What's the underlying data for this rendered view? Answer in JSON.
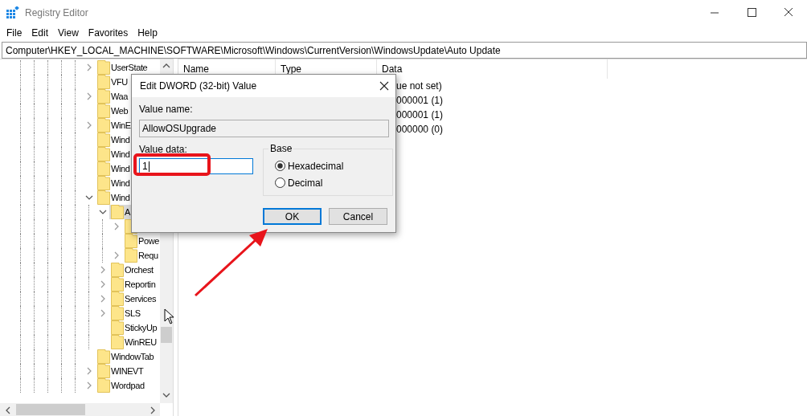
{
  "window": {
    "title": "Registry Editor"
  },
  "menu": [
    "File",
    "Edit",
    "View",
    "Favorites",
    "Help"
  ],
  "address": "Computer\\HKEY_LOCAL_MACHINE\\SOFTWARE\\Microsoft\\Windows\\CurrentVersion\\WindowsUpdate\\Auto Update",
  "tree": [
    {
      "label": "UserState",
      "expanded": false,
      "selected": false
    },
    {
      "label": "VFU",
      "selected": false
    },
    {
      "label": "Waa",
      "expanded": false,
      "selected": false
    },
    {
      "label": "Web",
      "selected": false
    },
    {
      "label": "WinE",
      "expanded": false,
      "selected": false
    },
    {
      "label": "Wind",
      "selected": false
    },
    {
      "label": "Wind",
      "selected": false
    },
    {
      "label": "Wind",
      "selected": false
    },
    {
      "label": "Wind",
      "selected": false
    },
    {
      "label": "Wind",
      "expanded": true,
      "selected": false,
      "children": [
        {
          "label": "A",
          "expanded": true,
          "selected": true,
          "children": [
            {
              "expanded": false,
              "selected": false
            },
            {
              "label": "Powe",
              "selected": false
            },
            {
              "label": "Requ",
              "expanded": false,
              "selected": false
            }
          ]
        },
        {
          "label": "Orchest",
          "expanded": false,
          "selected": false
        },
        {
          "label": "Reportin",
          "expanded": false,
          "selected": false
        },
        {
          "label": "Services",
          "expanded": false,
          "selected": false
        },
        {
          "label": "SLS",
          "expanded": false,
          "selected": false
        },
        {
          "label": "StickyUp",
          "selected": false
        },
        {
          "label": "WinREU",
          "selected": false
        }
      ]
    },
    {
      "label": "WindowTab",
      "selected": false
    },
    {
      "label": "WINEVT",
      "expanded": false,
      "selected": false
    },
    {
      "label": "Wordpad",
      "expanded": false,
      "selected": false
    }
  ],
  "values": {
    "columns": [
      "Name",
      "Type",
      "Data"
    ],
    "rows": [
      {
        "data": "ue not set)"
      },
      {
        "data": "000001 (1)"
      },
      {
        "data": "000001 (1)"
      },
      {
        "data": "000000 (0)"
      }
    ]
  },
  "dialog": {
    "title": "Edit DWORD (32-bit) Value",
    "name_label": "Value name:",
    "name_value": "AllowOSUpgrade",
    "data_label": "Value data:",
    "data_value": "1",
    "base_label": "Base",
    "base_options": [
      {
        "label": "Hexadecimal",
        "selected": true
      },
      {
        "label": "Decimal",
        "selected": false
      }
    ],
    "buttons": [
      {
        "label": "OK",
        "focused": true
      },
      {
        "label": "Cancel",
        "focused": false
      }
    ]
  }
}
